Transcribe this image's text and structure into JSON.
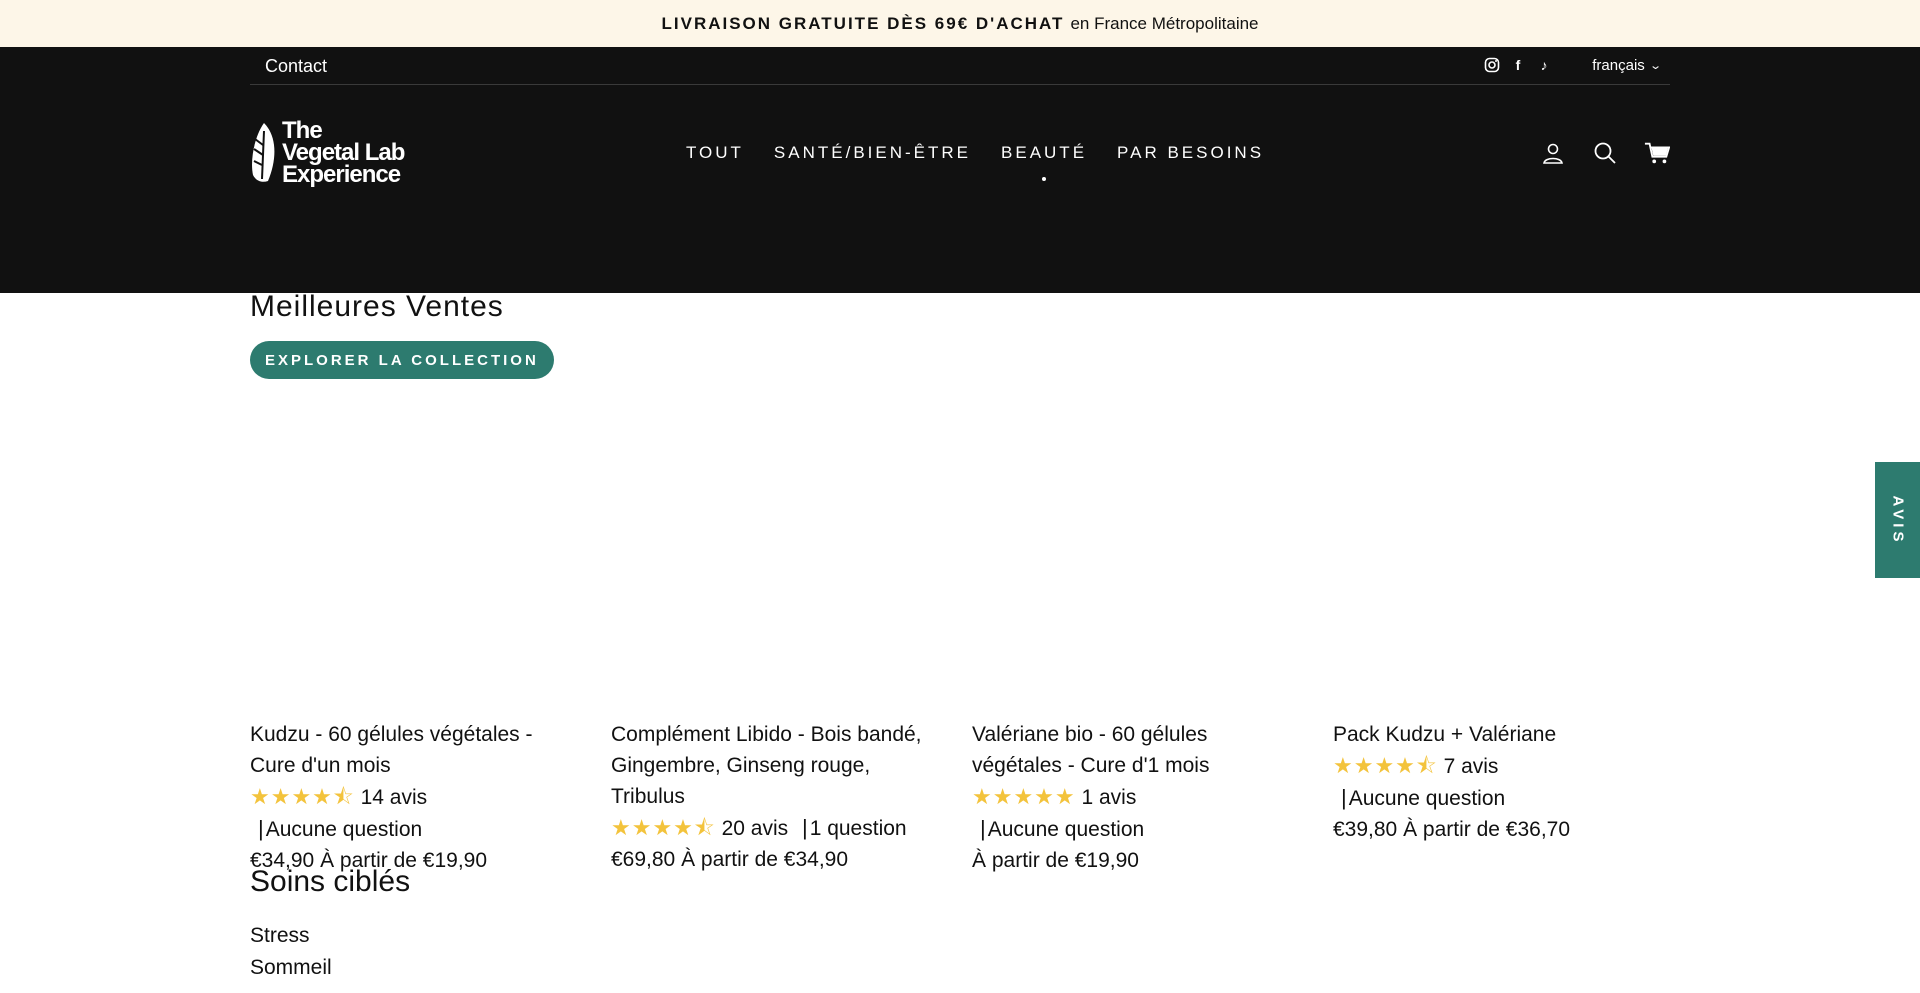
{
  "announcement": {
    "bold": "LIVRAISON GRATUITE DÈS 69€ D'ACHAT",
    "rest": "en France Métropolitaine"
  },
  "topbar": {
    "contact": "Contact",
    "language": "français"
  },
  "logo": {
    "line1": "The",
    "line2": "Vegetal Lab",
    "line3": "Experience"
  },
  "nav": [
    {
      "label": "TOUT"
    },
    {
      "label": "SANTÉ/BIEN-ÊTRE"
    },
    {
      "label": "BEAUTÉ"
    },
    {
      "label": "PAR BESOINS"
    }
  ],
  "section": {
    "title": "Meilleures Ventes",
    "button": "EXPLORER LA COLLECTION"
  },
  "products": [
    {
      "name": "Kudzu - 60 gélules végétales - Cure d'un mois",
      "rating": 4.5,
      "reviews": "14 avis",
      "questions": "Aucune question",
      "price": "€34,90",
      "from": "À partir de €19,90"
    },
    {
      "name": "Complément Libido - Bois bandé, Gingembre, Ginseng rouge, Tribulus",
      "rating": 4.5,
      "reviews": "20 avis",
      "questions": "1 question",
      "price": "€69,80",
      "from": "À partir de €34,90"
    },
    {
      "name": "Valériane bio - 60 gélules végétales - Cure d'1 mois",
      "rating": 5,
      "reviews": "1 avis",
      "questions": "Aucune question",
      "price": "",
      "from": "À partir de €19,90"
    },
    {
      "name": "Pack Kudzu + Valériane",
      "rating": 4.5,
      "reviews": "7 avis",
      "questions": "Aucune question",
      "price": "€39,80",
      "from": "À partir de €36,70"
    }
  ],
  "soins": {
    "title": "Soins ciblés",
    "items": [
      "Stress",
      "Sommeil"
    ]
  },
  "avis_tab": "AVIS",
  "colors": {
    "accent": "#2d7b6f",
    "header": "#111111",
    "announce_bg": "#fdf6e8",
    "stars": "#f3c33c"
  }
}
